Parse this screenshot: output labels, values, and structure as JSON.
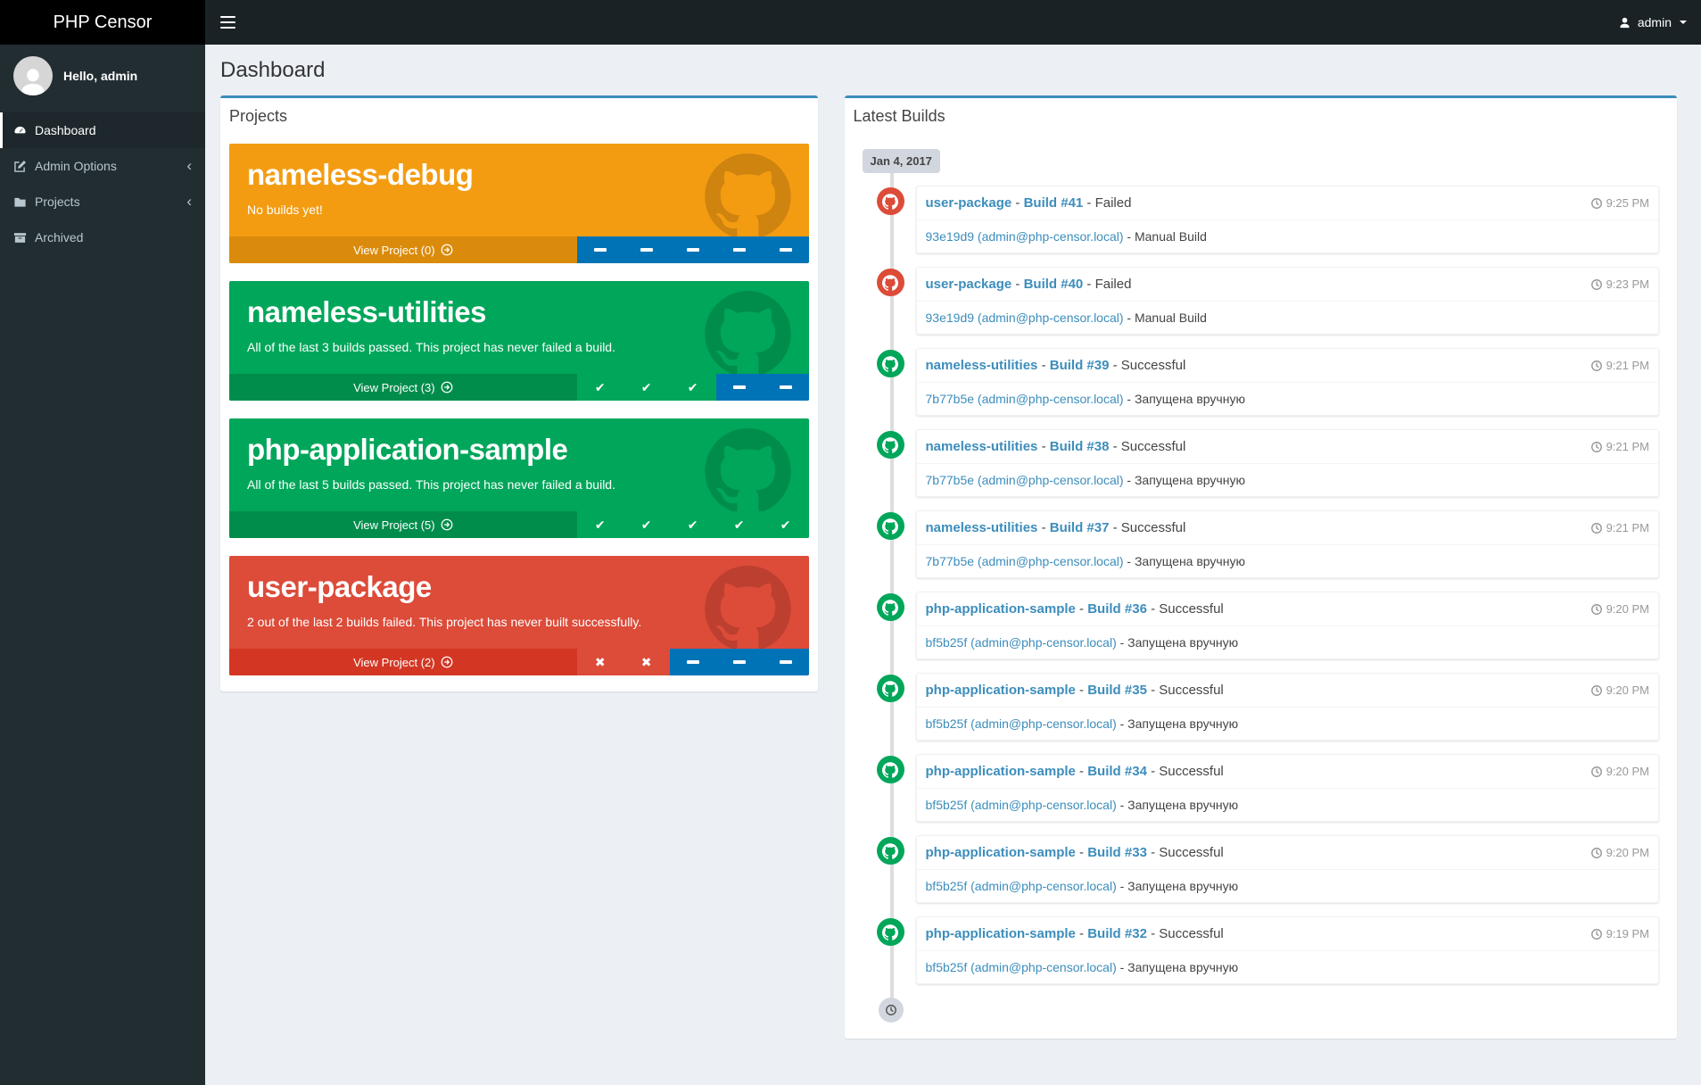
{
  "header": {
    "brand": "PHP Censor",
    "user_name": "admin"
  },
  "sidebar": {
    "greeting": "Hello, admin",
    "items": [
      {
        "label": "Dashboard",
        "icon": "gauge-icon",
        "active": true,
        "has_submenu": false
      },
      {
        "label": "Admin Options",
        "icon": "edit-icon",
        "active": false,
        "has_submenu": true
      },
      {
        "label": "Projects",
        "icon": "folder-icon",
        "active": false,
        "has_submenu": true
      },
      {
        "label": "Archived",
        "icon": "archive-icon",
        "active": false,
        "has_submenu": false
      }
    ]
  },
  "page": {
    "title": "Dashboard"
  },
  "icons": {
    "chevron_left": "‹",
    "check": "✔",
    "cross": "✖"
  },
  "projects_panel": {
    "title": "Projects",
    "cards": [
      {
        "name": "nameless-debug",
        "description": "No builds yet!",
        "color": "orange",
        "view_label": "View Project (0)",
        "statuses": [
          "none",
          "none",
          "none",
          "none",
          "none"
        ]
      },
      {
        "name": "nameless-utilities",
        "description": "All of the last 3 builds passed. This project has never failed a build.",
        "color": "green",
        "view_label": "View Project (3)",
        "statuses": [
          "ok",
          "ok",
          "ok",
          "none",
          "none"
        ]
      },
      {
        "name": "php-application-sample",
        "description": "All of the last 5 builds passed. This project has never failed a build.",
        "color": "green",
        "view_label": "View Project (5)",
        "statuses": [
          "ok",
          "ok",
          "ok",
          "ok",
          "ok"
        ]
      },
      {
        "name": "user-package",
        "description": "2 out of the last 2 builds failed. This project has never built successfully.",
        "color": "red",
        "view_label": "View Project (2)",
        "statuses": [
          "fail",
          "fail",
          "none",
          "none",
          "none"
        ]
      }
    ]
  },
  "builds_panel": {
    "title": "Latest Builds",
    "date_label": "Jan 4, 2017",
    "separator": " - ",
    "builds": [
      {
        "project": "user-package",
        "build": "Build #41",
        "status": "Failed",
        "ok": false,
        "commit": "93e19d9 (admin@php-censor.local)",
        "note": "Manual Build",
        "time": "9:25 PM"
      },
      {
        "project": "user-package",
        "build": "Build #40",
        "status": "Failed",
        "ok": false,
        "commit": "93e19d9 (admin@php-censor.local)",
        "note": "Manual Build",
        "time": "9:23 PM"
      },
      {
        "project": "nameless-utilities",
        "build": "Build #39",
        "status": "Successful",
        "ok": true,
        "commit": "7b77b5e (admin@php-censor.local)",
        "note": "Запущена вручную",
        "time": "9:21 PM"
      },
      {
        "project": "nameless-utilities",
        "build": "Build #38",
        "status": "Successful",
        "ok": true,
        "commit": "7b77b5e (admin@php-censor.local)",
        "note": "Запущена вручную",
        "time": "9:21 PM"
      },
      {
        "project": "nameless-utilities",
        "build": "Build #37",
        "status": "Successful",
        "ok": true,
        "commit": "7b77b5e (admin@php-censor.local)",
        "note": "Запущена вручную",
        "time": "9:21 PM"
      },
      {
        "project": "php-application-sample",
        "build": "Build #36",
        "status": "Successful",
        "ok": true,
        "commit": "bf5b25f (admin@php-censor.local)",
        "note": "Запущена вручную",
        "time": "9:20 PM"
      },
      {
        "project": "php-application-sample",
        "build": "Build #35",
        "status": "Successful",
        "ok": true,
        "commit": "bf5b25f (admin@php-censor.local)",
        "note": "Запущена вручную",
        "time": "9:20 PM"
      },
      {
        "project": "php-application-sample",
        "build": "Build #34",
        "status": "Successful",
        "ok": true,
        "commit": "bf5b25f (admin@php-censor.local)",
        "note": "Запущена вручную",
        "time": "9:20 PM"
      },
      {
        "project": "php-application-sample",
        "build": "Build #33",
        "status": "Successful",
        "ok": true,
        "commit": "bf5b25f (admin@php-censor.local)",
        "note": "Запущена вручную",
        "time": "9:20 PM"
      },
      {
        "project": "php-application-sample",
        "build": "Build #32",
        "status": "Successful",
        "ok": true,
        "commit": "bf5b25f (admin@php-censor.local)",
        "note": "Запущена вручную",
        "time": "9:19 PM"
      }
    ]
  },
  "colors": {
    "accent": "#3c8dbc",
    "success": "#00a65a",
    "failed": "#dd4b39",
    "pending": "#0073b7",
    "warning": "#f39c12",
    "navbar_bg": "#1a2226",
    "logo_bg": "#000000",
    "sidebar_bg": "#222d32",
    "page_bg": "#ecf0f5",
    "timeline_line": "#dddddd"
  }
}
